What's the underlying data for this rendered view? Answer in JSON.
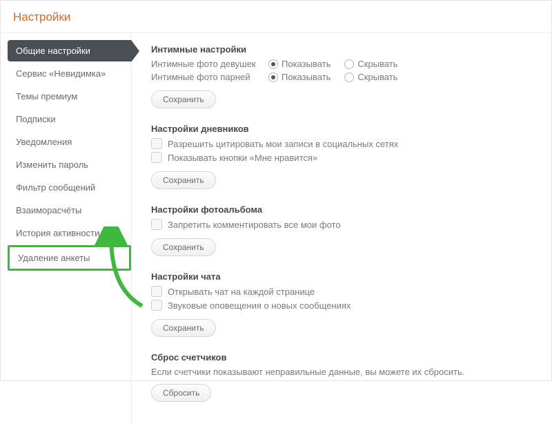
{
  "page_title": "Настройки",
  "sidebar": {
    "items": [
      {
        "label": "Общие настройки",
        "active": true
      },
      {
        "label": "Сервис «Невидимка»"
      },
      {
        "label": "Темы премиум"
      },
      {
        "label": "Подписки"
      },
      {
        "label": "Уведомления"
      },
      {
        "label": "Изменить пароль"
      },
      {
        "label": "Фильтр сообщений"
      },
      {
        "label": "Взаиморасчёты"
      },
      {
        "label": "История активности"
      },
      {
        "label": "Удаление анкеты",
        "highlighted": true
      }
    ]
  },
  "sections": {
    "intimate": {
      "title": "Интимные настройки",
      "row1_label": "Интимные фото девушек",
      "row2_label": "Интимные фото парней",
      "opt_show": "Показывать",
      "opt_hide": "Скрывать",
      "save": "Сохранить"
    },
    "diary": {
      "title": "Настройки дневников",
      "chk1": "Разрешить цитировать мои записи в социальных сетях",
      "chk2": "Показывать кнопки «Мне нравится»",
      "save": "Сохранить"
    },
    "album": {
      "title": "Настройки фотоальбома",
      "chk1": "Запретить комментировать все мои фото",
      "save": "Сохранить"
    },
    "chat": {
      "title": "Настройки чата",
      "chk1": "Открывать чат на каждой странице",
      "chk2": "Звуковые оповещения о новых сообщениях",
      "save": "Сохранить"
    },
    "counters": {
      "title": "Сброс счетчиков",
      "desc": "Если счетчики показывают неправильные данные, вы можете их сбросить.",
      "reset": "Сбросить"
    }
  }
}
